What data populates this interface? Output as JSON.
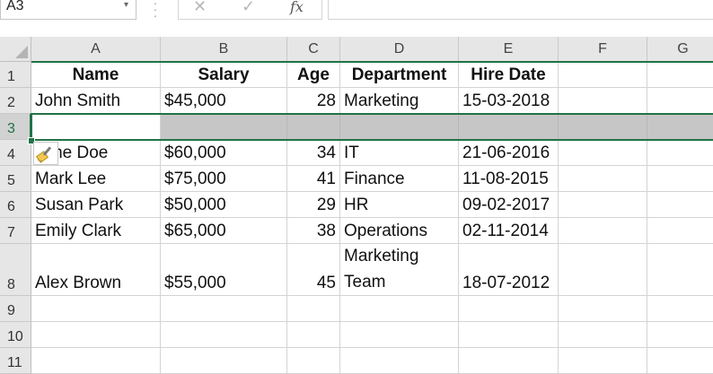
{
  "formula_bar": {
    "name_box": "A3",
    "name_box_arrow": "▾",
    "dots": "⋮",
    "cancel": "✕",
    "enter": "✓",
    "fx": "fx",
    "content": ""
  },
  "columns": [
    "A",
    "B",
    "C",
    "D",
    "E",
    "F",
    "G"
  ],
  "rows": [
    {
      "num": "1",
      "cells": [
        "Name",
        "Salary",
        "Age",
        "Department",
        "Hire Date",
        "",
        ""
      ]
    },
    {
      "num": "2",
      "cells": [
        "John Smith",
        "$45,000",
        "28",
        "Marketing",
        "15-03-2018",
        "",
        ""
      ]
    },
    {
      "num": "3",
      "cells": [
        "",
        "",
        "",
        "",
        "",
        "",
        ""
      ]
    },
    {
      "num": "4",
      "cells": [
        "Jane Doe",
        "$60,000",
        "34",
        "IT",
        "21-06-2016",
        "",
        ""
      ]
    },
    {
      "num": "5",
      "cells": [
        "Mark Lee",
        "$75,000",
        "41",
        "Finance",
        "11-08-2015",
        "",
        ""
      ]
    },
    {
      "num": "6",
      "cells": [
        "Susan Park",
        "$50,000",
        "29",
        "HR",
        "09-02-2017",
        "",
        ""
      ]
    },
    {
      "num": "7",
      "cells": [
        "Emily Clark",
        "$65,000",
        "38",
        "Operations",
        "02-11-2014",
        "",
        ""
      ]
    },
    {
      "num": "8",
      "cells": [
        "Alex Brown",
        "$55,000",
        "45",
        "Marketing Team",
        "18-07-2012",
        "",
        ""
      ]
    },
    {
      "num": "9",
      "cells": [
        "",
        "",
        "",
        "",
        "",
        "",
        ""
      ]
    },
    {
      "num": "10",
      "cells": [
        "",
        "",
        "",
        "",
        "",
        "",
        ""
      ]
    },
    {
      "num": "11",
      "cells": [
        "",
        "",
        "",
        "",
        "",
        "",
        ""
      ]
    }
  ],
  "selected_row": "3",
  "paste_options_icon": "paintbrush-icon",
  "colors": {
    "accent": "#217346",
    "selection": "#c6c6c6",
    "header_bg": "#e6e6e6"
  }
}
